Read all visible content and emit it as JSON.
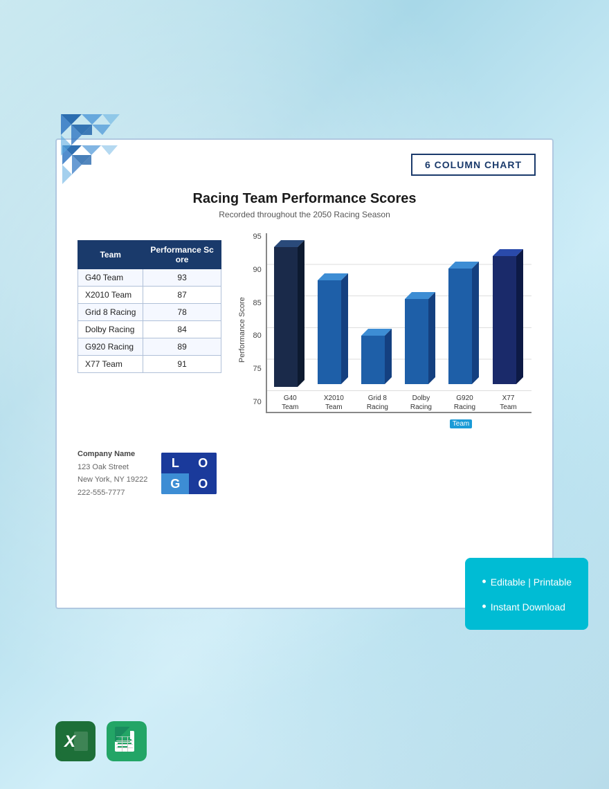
{
  "card": {
    "badge": "6 COLUMN CHART",
    "chart_title": "Racing Team Performance Scores",
    "chart_subtitle": "Recorded throughout the 2050 Racing Season"
  },
  "table": {
    "headers": [
      "Team",
      "Performance Score"
    ],
    "rows": [
      {
        "team": "G40 Team",
        "score": "93"
      },
      {
        "team": "X2010 Team",
        "score": "87"
      },
      {
        "team": "Grid 8 Racing",
        "score": "78"
      },
      {
        "team": "Dolby Racing",
        "score": "84"
      },
      {
        "team": "G920 Racing",
        "score": "89"
      },
      {
        "team": "X77 Team",
        "score": "91"
      }
    ]
  },
  "chart": {
    "y_axis_label": "Performance Score",
    "y_ticks": [
      "95",
      "90",
      "85",
      "80",
      "75",
      "70"
    ],
    "bars": [
      {
        "label_line1": "G40",
        "label_line2": "Team",
        "value": 93,
        "highlight": false
      },
      {
        "label_line1": "X2010",
        "label_line2": "Team",
        "value": 87,
        "highlight": false
      },
      {
        "label_line1": "Grid 8",
        "label_line2": "Racing",
        "value": 78,
        "highlight": false
      },
      {
        "label_line1": "Dolby",
        "label_line2": "Racing",
        "value": 84,
        "highlight": false
      },
      {
        "label_line1": "G920",
        "label_line2": "Racing",
        "value": 89,
        "highlight": false
      },
      {
        "label_line1": "X77",
        "label_line2": "Team",
        "value": 91,
        "highlight": false
      }
    ],
    "highlighted_label": "Team",
    "x_min": 70,
    "x_max": 95
  },
  "footer": {
    "company_name": "Company Name",
    "address_line1": "123 Oak Street",
    "address_line2": "New York, NY 19222",
    "phone": "222-555-7777",
    "logo_tl": "L",
    "logo_tr": "O",
    "logo_bl": "G",
    "logo_br": "O"
  },
  "teal_badge": {
    "item1": "Editable | Printable",
    "item2": "Instant Download"
  }
}
